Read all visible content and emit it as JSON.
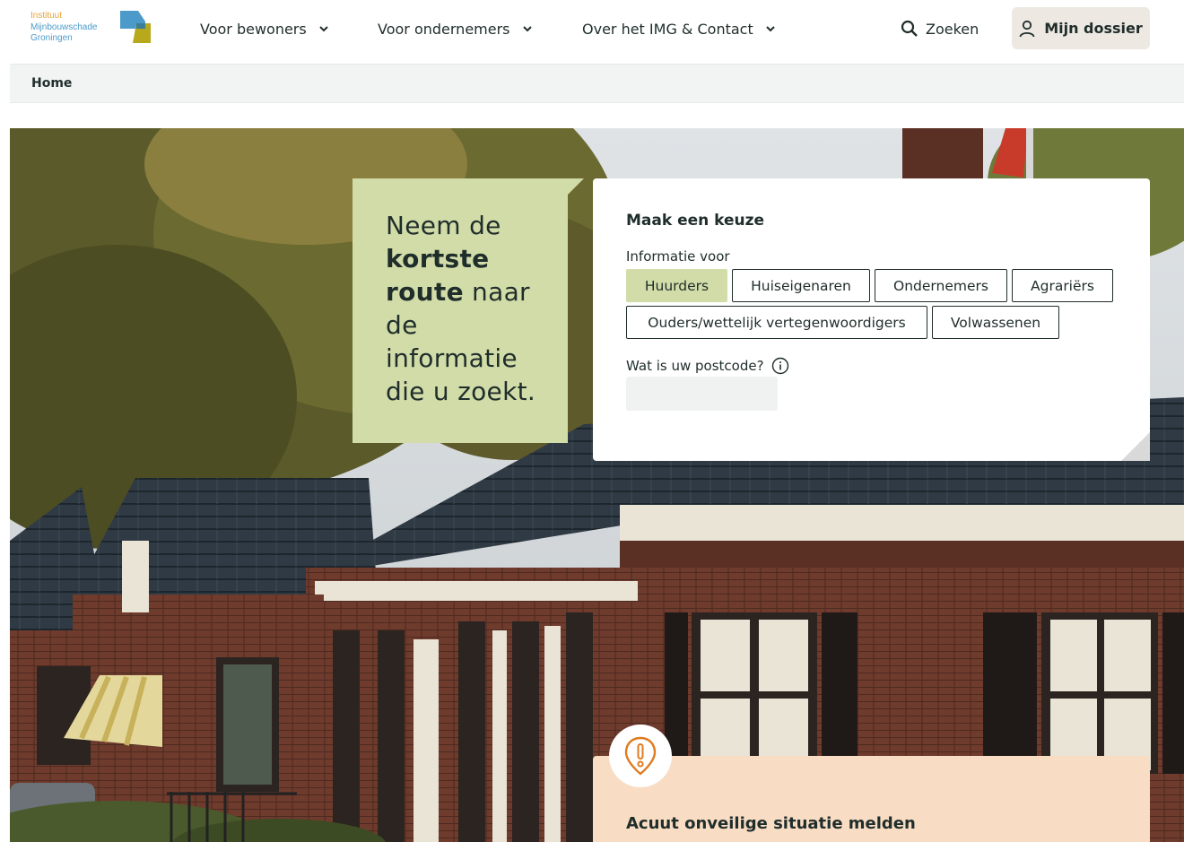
{
  "logo": {
    "lines": [
      "Instituut",
      "Mijnbouwschade",
      "Groningen"
    ],
    "colors": {
      "orange": "#e5a53b",
      "blue": "#4b9ac9",
      "green": "#b7a81c"
    }
  },
  "nav": {
    "items": [
      {
        "label": "Voor bewoners"
      },
      {
        "label": "Voor ondernemers"
      },
      {
        "label": "Over het IMG & Contact"
      }
    ],
    "search_label": "Zoeken",
    "dossier_label": "Mijn dossier"
  },
  "breadcrumb": {
    "home": "Home"
  },
  "tagline": {
    "part1": "Neem de ",
    "bold": "kortste route",
    "part2": " naar de informatie die u zoekt."
  },
  "choice": {
    "title": "Maak een keuze",
    "info_label": "Informatie voor",
    "options": [
      {
        "label": "Huurders",
        "active": true
      },
      {
        "label": "Huiseigenaren",
        "active": false
      },
      {
        "label": "Ondernemers",
        "active": false
      },
      {
        "label": "Agrariërs",
        "active": false
      },
      {
        "label": "Ouders/wettelijk vertegenwoordigers",
        "active": false
      },
      {
        "label": "Volwassenen",
        "active": false
      }
    ],
    "postcode_label": "Wat is uw postcode?",
    "postcode_value": ""
  },
  "alert": {
    "title": "Acuut onveilige situatie melden",
    "icon": "alert-pin-icon"
  },
  "colors": {
    "accent_green": "#d2dca8",
    "alert_peach": "#f8dcc3",
    "alert_orange": "#e07b1f",
    "text": "#1f2d2b"
  }
}
